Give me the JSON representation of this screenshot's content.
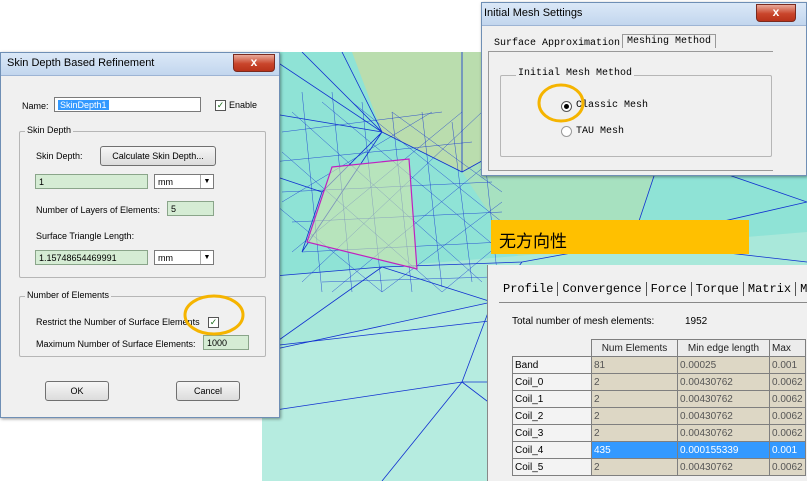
{
  "skin_depth_dialog": {
    "title": "Skin Depth Based Refinement",
    "close_label": "x",
    "name_label": "Name:",
    "name_value": "SkinDepth1",
    "enable_label": "Enable",
    "enable_checked": true,
    "skin_depth_group": "Skin Depth",
    "skin_depth_label": "Skin Depth:",
    "calculate_button": "Calculate Skin Depth...",
    "skin_depth_value": "1",
    "skin_depth_unit": "mm",
    "layers_label": "Number of Layers of Elements:",
    "layers_value": "5",
    "triangle_label": "Surface Triangle Length:",
    "triangle_value": "1.15748654469991",
    "triangle_unit": "mm",
    "num_elements_group": "Number of Elements",
    "restrict_label": "Restrict the Number of Surface Elements",
    "restrict_checked": true,
    "max_label": "Maximum Number of Surface Elements:",
    "max_value": "1000",
    "ok_button": "OK",
    "cancel_button": "Cancel"
  },
  "initial_mesh_dialog": {
    "title": "Initial Mesh Settings",
    "close_label": "x",
    "tabs": [
      "Surface Approximation",
      "Meshing Method"
    ],
    "group_label": "Initial Mesh Method",
    "options": [
      "Classic Mesh",
      "TAU Mesh"
    ],
    "selected_option": "Classic Mesh"
  },
  "banner": {
    "text": "无方向性",
    "color": "#ffc000"
  },
  "mesh_stats": {
    "tabs": [
      "Profile",
      "Convergence",
      "Force",
      "Torque",
      "Matrix",
      "M"
    ],
    "total_label": "Total number of mesh elements:",
    "total_value": "1952",
    "columns": [
      "Num Elements",
      "Min edge length",
      "Max"
    ],
    "rows": [
      {
        "name": "Band",
        "num": "81",
        "min": "0.00025",
        "max": "0.001"
      },
      {
        "name": "Coil_0",
        "num": "2",
        "min": "0.00430762",
        "max": "0.0062"
      },
      {
        "name": "Coil_1",
        "num": "2",
        "min": "0.00430762",
        "max": "0.0062"
      },
      {
        "name": "Coil_2",
        "num": "2",
        "min": "0.00430762",
        "max": "0.0062"
      },
      {
        "name": "Coil_3",
        "num": "2",
        "min": "0.00430762",
        "max": "0.0062"
      },
      {
        "name": "Coil_4",
        "num": "435",
        "min": "0.000155339",
        "max": "0.001",
        "selected": true
      },
      {
        "name": "Coil_5",
        "num": "2",
        "min": "0.00430762",
        "max": "0.0062"
      }
    ]
  },
  "colors": {
    "highlight_ring": "#f5b400",
    "mesh_line": "#1030d0",
    "mesh_fill_light": "#8fe3d6",
    "mesh_fill_khaki": "#c8dba0",
    "outline_square": "#c020c0"
  }
}
